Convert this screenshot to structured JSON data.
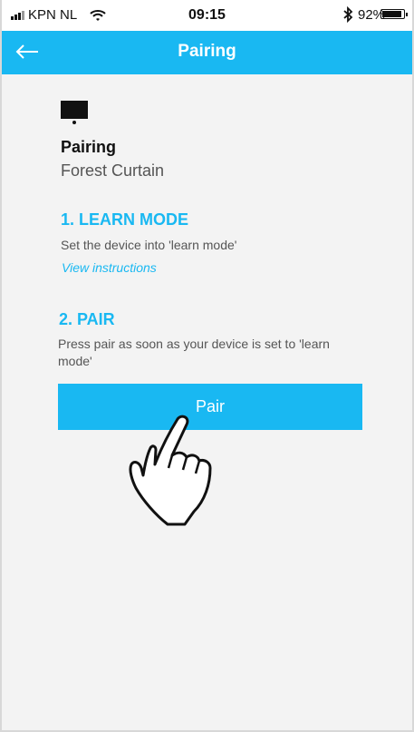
{
  "status_bar": {
    "carrier": "KPN NL",
    "time": "09:15",
    "battery_percent": "92%",
    "battery_level": 0.92,
    "icons": [
      "signal-icon",
      "wifi-icon",
      "bluetooth-icon",
      "battery-icon"
    ]
  },
  "nav": {
    "title": "Pairing",
    "back_icon": "back-arrow-icon"
  },
  "device": {
    "icon": "device-icon",
    "title": "Pairing",
    "name": "Forest Curtain"
  },
  "steps": [
    {
      "heading": "1. LEARN MODE",
      "text": "Set the device into 'learn mode'",
      "link": "View instructions"
    },
    {
      "heading": "2. PAIR",
      "text": "Press pair as soon as your device is set to 'learn mode'"
    }
  ],
  "actions": {
    "pair_label": "Pair"
  },
  "overlay": {
    "cursor_icon": "hand-pointer-icon"
  },
  "colors": {
    "accent": "#19b8f2",
    "background": "#f3f3f3",
    "text_primary": "#111111",
    "text_secondary": "#555555"
  }
}
